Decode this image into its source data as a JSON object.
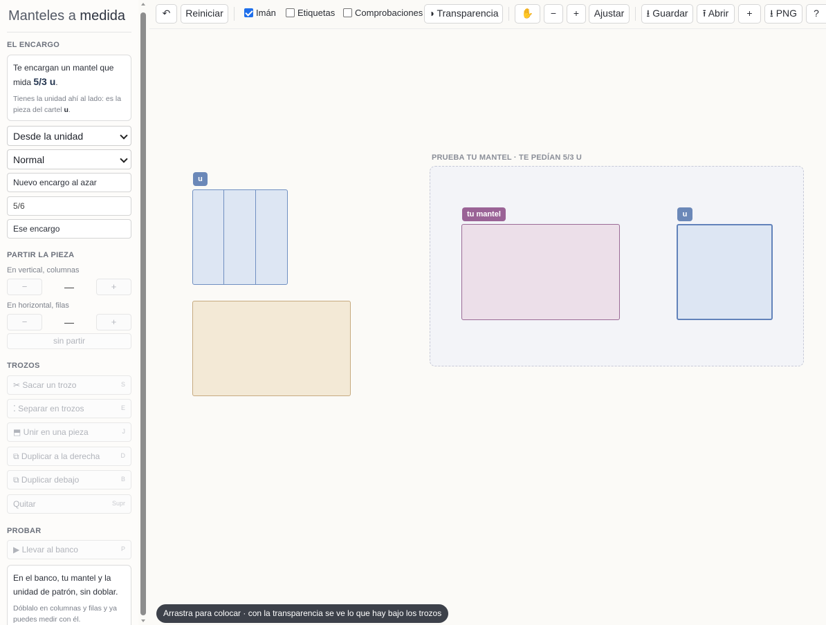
{
  "sidebar": {
    "title_normal": "Manteles a",
    "title_bold": "medida",
    "encargo": {
      "heading": "EL ENCARGO",
      "line1": "Te encargan un mantel que mida",
      "amount": "5/3 u",
      "tail": ".",
      "hint_text": "Tienes la unidad ahí al lado: es la pieza del cartel",
      "hint_bold": "u",
      "hint_end": ".",
      "mode_select": "Desde la unidad",
      "level_select": "Normal",
      "random_button": "Nuevo encargo al azar",
      "fraction_input": "5/6",
      "apply_button": "Ese encargo"
    },
    "partir": {
      "heading": "PARTIR LA PIEZA",
      "vertical_label": "En vertical, columnas",
      "horizontal_label": "En horizontal, filas",
      "minus": "−",
      "plus": "+",
      "vertical_value": "—",
      "horizontal_value": "—",
      "no_split": "sin partir"
    },
    "trozos": {
      "heading": "TROZOS",
      "items": [
        {
          "label": "✂ Sacar un trozo",
          "key": "S"
        },
        {
          "label": "⁚ Separar en trozos",
          "key": "E"
        },
        {
          "label": "⬒ Unir en una pieza",
          "key": "J"
        },
        {
          "label": "⧉ Duplicar a la derecha",
          "key": "D"
        },
        {
          "label": "⧉ Duplicar debajo",
          "key": "B"
        },
        {
          "label": "Quitar",
          "key": "Supr"
        }
      ]
    },
    "probar": {
      "heading": "PROBAR",
      "bench_button": "▶ Llevar al banco",
      "bench_key": "P",
      "info_main": "En el banco, tu mantel y la unidad de patrón, sin doblar.",
      "info_sub": "Dóblalo en columnas y filas y ya puedes medir con él."
    }
  },
  "toolbar": {
    "undo": "↶",
    "reset": "Reiniciar",
    "magnet": "Imán",
    "magnet_checked": true,
    "labels": "Etiquetas",
    "labels_checked": false,
    "checks": "Comprobaciones",
    "checks_checked": false,
    "transparency": "◑ Transparencia",
    "hand": "✋",
    "zoom_out": "−",
    "zoom_in": "+",
    "fit": "Ajustar",
    "save": "⭳ Guardar",
    "open": "⭱ Abrir",
    "add": "+",
    "png": "⭳ PNG",
    "help": "?"
  },
  "canvas": {
    "unit_tag": "u",
    "bench_title": "PRUEBA TU MANTEL · TE PEDÍAN 5/3 U",
    "mantel_tag": "tu mantel",
    "bench_unit_tag": "u"
  },
  "status": "Arrastra para colocar · con la transparencia se ve lo que hay bajo los trozos"
}
